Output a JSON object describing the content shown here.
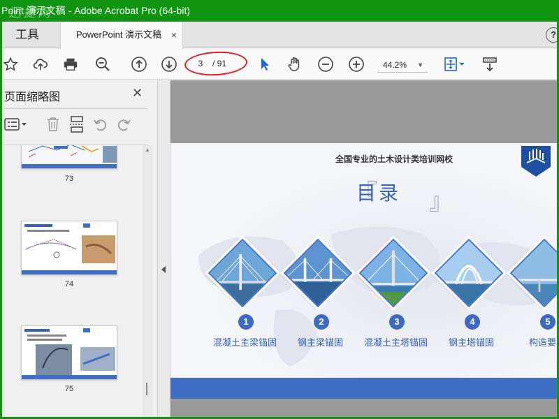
{
  "window": {
    "title": "Point 演示文稿 - Adobe Acrobat Pro (64-bit)",
    "watermark": "迅捷网"
  },
  "tabs": {
    "tools_label": "工具",
    "doc_label": "PowerPoint 演示文稿",
    "close_glyph": "×",
    "help_glyph": "?"
  },
  "toolbar": {
    "page_current": "3",
    "page_total": "/ 91",
    "zoom_value": "44.2%",
    "zoom_caret": "▼",
    "icons": [
      "star-icon",
      "cloud-upload-icon",
      "print-icon",
      "zoom-out-search-icon",
      "prev-page-icon",
      "next-page-icon",
      "select-arrow-icon",
      "hand-icon",
      "zoom-out-icon",
      "zoom-in-icon",
      "fit-page-icon",
      "scroll-mode-icon"
    ]
  },
  "sidebar": {
    "title": "页面缩略图",
    "close_glyph": "✕",
    "thumbnails": [
      {
        "page": "73"
      },
      {
        "page": "74"
      },
      {
        "page": "75"
      }
    ]
  },
  "slide": {
    "header": "全国专业的土木设计类培训网校",
    "title": "目录",
    "bracket_left": "『",
    "bracket_right": "』",
    "items": [
      {
        "num": "1",
        "label": "混凝土主梁锚固"
      },
      {
        "num": "2",
        "label": "钢主梁锚固"
      },
      {
        "num": "3",
        "label": "混凝土主塔锚固"
      },
      {
        "num": "4",
        "label": "钢主塔锚固"
      },
      {
        "num": "5",
        "label": "构造要"
      }
    ],
    "colors": {
      "accent": "#3e6fc4",
      "label": "#2f5fb5"
    }
  },
  "colors": {
    "titlebar": "#119411",
    "annotation": "#e02020"
  }
}
